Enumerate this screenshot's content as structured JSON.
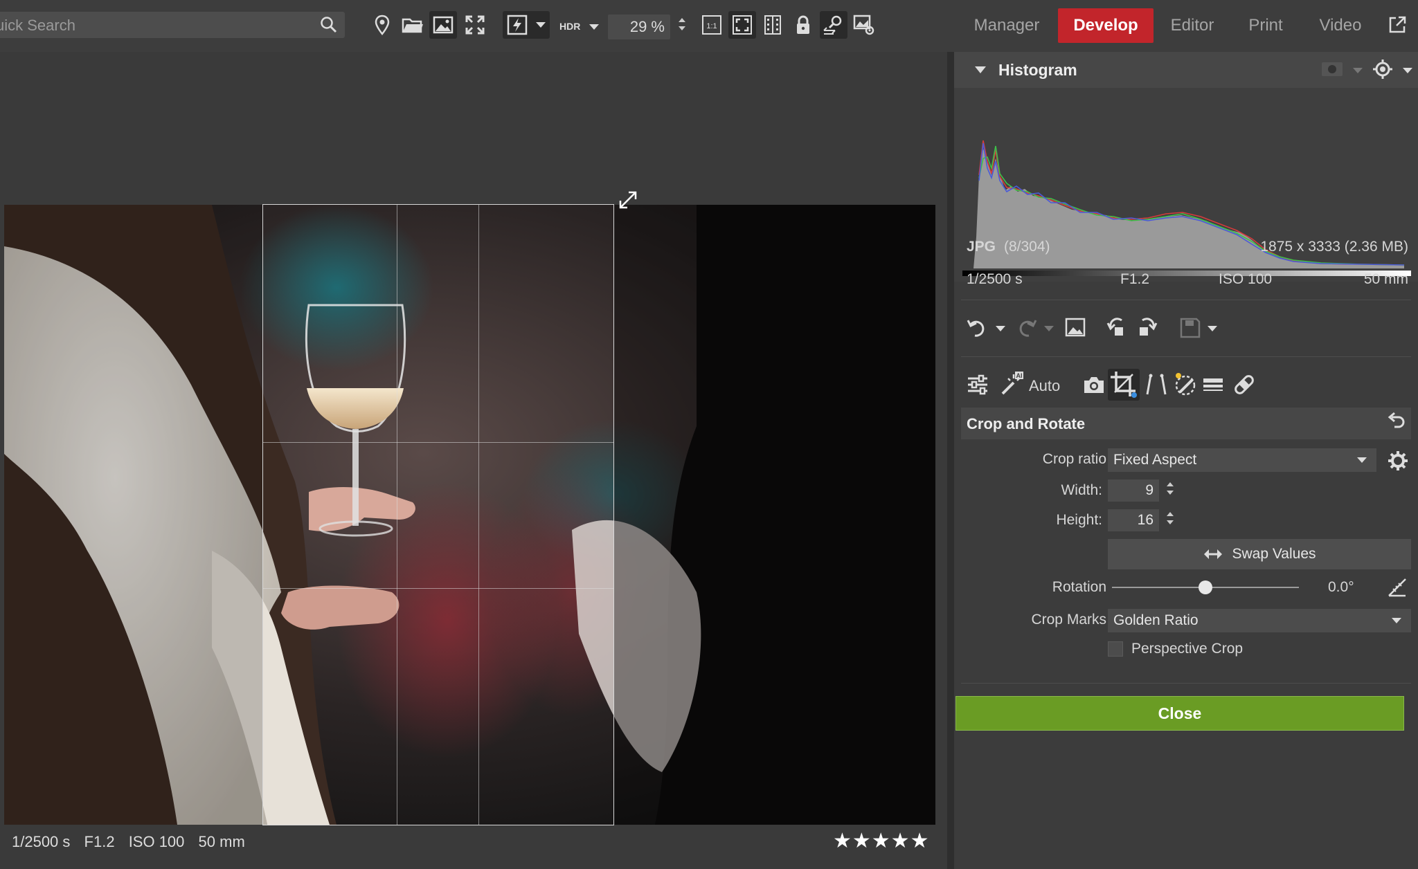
{
  "search": {
    "placeholder": "uick Search"
  },
  "toolbar": {
    "hdr_label": "HDR",
    "zoom_value": "29 %",
    "icons": [
      "search-icon",
      "location-pin-icon",
      "folder-open-icon",
      "image-icon",
      "fit-screen-icon",
      "flash-auto-icon",
      "one-to-one-icon",
      "zoom-fit-icon",
      "compare-icon",
      "lock-icon",
      "zoom-person-icon",
      "image-settings-icon"
    ]
  },
  "modes": {
    "manager": "Manager",
    "develop": "Develop",
    "editor": "Editor",
    "print": "Print",
    "video": "Video",
    "active": "Develop",
    "active_color": "#c2252b"
  },
  "viewer": {
    "exif": {
      "shutter": "1/2500 s",
      "aperture": "F1.2",
      "iso": "ISO 100",
      "focal": "50 mm"
    },
    "rating_stars": "★★★★★",
    "rating": 5
  },
  "panel": {
    "histogram": {
      "title": "Histogram",
      "format": "JPG",
      "index": "(8/304)",
      "dimensions": "1875 x 3333 (2.36 MB)",
      "shutter": "1/2500 s",
      "aperture": "F1.2",
      "iso": "ISO 100",
      "focal": "50 mm"
    },
    "tools": {
      "auto_label": "Auto"
    },
    "crop": {
      "title": "Crop and Rotate",
      "crop_ratio_label": "Crop ratio",
      "crop_ratio_value": "Fixed Aspect",
      "width_label": "Width:",
      "width_value": "9",
      "height_label": "Height:",
      "height_value": "16",
      "swap_label": "Swap Values",
      "rotation_label": "Rotation",
      "rotation_value": "0.0°",
      "rotation_slider_fraction": 0.5,
      "crop_marks_label": "Crop Marks",
      "crop_marks_value": "Golden Ratio",
      "perspective_label": "Perspective Crop",
      "perspective_checked": false
    },
    "close_label": "Close",
    "close_color": "#6a9c24"
  }
}
